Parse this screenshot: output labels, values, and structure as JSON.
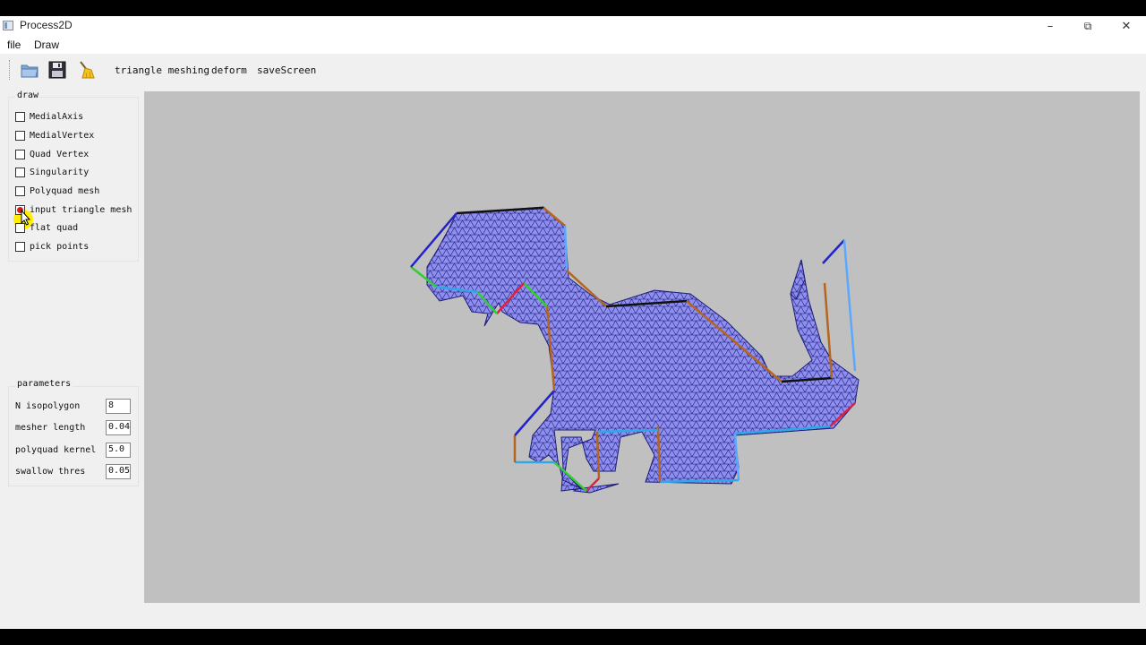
{
  "window": {
    "title": "Process2D",
    "controls": {
      "minimize": "–",
      "maximize": "⧉",
      "close": "✕"
    }
  },
  "menu": {
    "items": [
      "file",
      "Draw"
    ]
  },
  "toolbar": {
    "icons": [
      "open-folder-icon",
      "save-icon",
      "broom-icon"
    ],
    "actions": [
      "triangle meshing",
      "deform",
      "saveScreen"
    ]
  },
  "draw_panel": {
    "title": "draw",
    "options": [
      {
        "label": "MedialAxis",
        "checked": false
      },
      {
        "label": "MedialVertex",
        "checked": false
      },
      {
        "label": "Quad Vertex",
        "checked": false
      },
      {
        "label": "Singularity",
        "checked": false
      },
      {
        "label": "Polyquad mesh",
        "checked": false
      },
      {
        "label": "input triangle mesh",
        "checked": true
      },
      {
        "label": "flat quad",
        "checked": false
      },
      {
        "label": "pick points",
        "checked": false
      }
    ]
  },
  "parameters_panel": {
    "title": "parameters",
    "rows": [
      {
        "label": "N isopolygon",
        "value": "8"
      },
      {
        "label": "mesher length",
        "value": "0.04"
      },
      {
        "label": "polyquad kernel",
        "value": "5.0"
      },
      {
        "label": "swallow thres",
        "value": "0.05"
      }
    ]
  },
  "viewport": {
    "background": "#c0c0c0",
    "mesh_fill": "#8f8ff0",
    "mesh_edge": "#1c1c78"
  }
}
